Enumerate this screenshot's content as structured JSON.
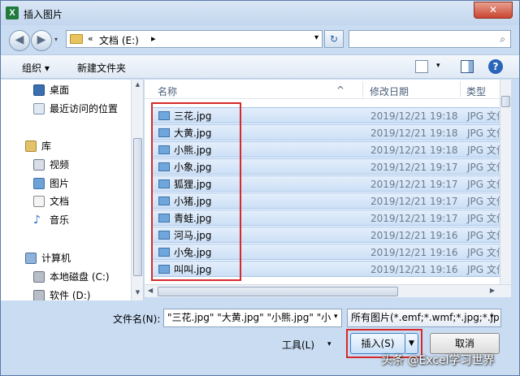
{
  "window": {
    "title": "插入图片",
    "close_label": "✕",
    "app_icon_letter": "X"
  },
  "address": {
    "chevrons": "«",
    "path": "文档 (E:)",
    "arrow": "▸",
    "drop": "▾",
    "refresh": "↻",
    "search_placeholder": "",
    "search_icon": "⌕",
    "back": "◀",
    "forward": "▶",
    "nav_drop": "▾"
  },
  "toolbar": {
    "organize": "组织 ▾",
    "new_folder": "新建文件夹",
    "view_drop": "▾",
    "help": "?"
  },
  "navpane": {
    "items": [
      {
        "label": "桌面",
        "icon": "desktop-icon"
      },
      {
        "label": "最近访问的位置",
        "icon": "recent-places-icon"
      },
      {
        "label": "库",
        "icon": "library-icon"
      },
      {
        "label": "视频",
        "icon": "video-icon"
      },
      {
        "label": "图片",
        "icon": "pictures-icon"
      },
      {
        "label": "文档",
        "icon": "documents-icon"
      },
      {
        "label": "音乐",
        "icon": "music-icon"
      },
      {
        "label": "计算机",
        "icon": "computer-icon"
      },
      {
        "label": "本地磁盘 (C:)",
        "icon": "disk-icon"
      },
      {
        "label": "软件 (D:)",
        "icon": "disk-icon"
      }
    ]
  },
  "filelist": {
    "columns": {
      "name": "名称",
      "date": "修改日期",
      "type": "类型"
    },
    "files": [
      {
        "name": "三花.jpg",
        "date": "2019/12/21 19:18",
        "type": "JPG 文件"
      },
      {
        "name": "大黄.jpg",
        "date": "2019/12/21 19:18",
        "type": "JPG 文件"
      },
      {
        "name": "小熊.jpg",
        "date": "2019/12/21 19:18",
        "type": "JPG 文件"
      },
      {
        "name": "小象.jpg",
        "date": "2019/12/21 19:17",
        "type": "JPG 文件"
      },
      {
        "name": "狐狸.jpg",
        "date": "2019/12/21 19:17",
        "type": "JPG 文件"
      },
      {
        "name": "小猪.jpg",
        "date": "2019/12/21 19:17",
        "type": "JPG 文件"
      },
      {
        "name": "青蛙.jpg",
        "date": "2019/12/21 19:17",
        "type": "JPG 文件"
      },
      {
        "name": "河马.jpg",
        "date": "2019/12/21 19:16",
        "type": "JPG 文件"
      },
      {
        "name": "小兔.jpg",
        "date": "2019/12/21 19:16",
        "type": "JPG 文件"
      },
      {
        "name": "叫叫.jpg",
        "date": "2019/12/21 19:16",
        "type": "JPG 文件"
      }
    ]
  },
  "footer": {
    "filename_label": "文件名(N):",
    "filename_value": "\"三花.jpg\" \"大黄.jpg\" \"小熊.jpg\" \"小",
    "filetype_value": "所有图片(*.emf;*.wmf;*.jpg;*.jp",
    "tools": "工具(L)",
    "insert": "插入(S)",
    "cancel": "取消",
    "dropdown": "▾",
    "split_arrow": "▼"
  },
  "watermark": "头条 @Excel学习世界"
}
